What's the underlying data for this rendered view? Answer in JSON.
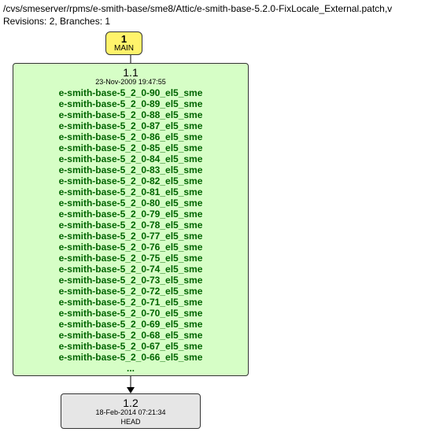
{
  "header": {
    "path": "/cvs/smeserver/rpms/e-smith-base/sme8/Attic/e-smith-base-5.2.0-FixLocale_External.patch,v",
    "revisions_label": "Revisions: 2, Branches: 1"
  },
  "badge": {
    "number": "1",
    "label": "MAIN"
  },
  "node1": {
    "version": "1.1",
    "timestamp": "23-Nov-2009 19:47:55",
    "tags": [
      "e-smith-base-5_2_0-90_el5_sme",
      "e-smith-base-5_2_0-89_el5_sme",
      "e-smith-base-5_2_0-88_el5_sme",
      "e-smith-base-5_2_0-87_el5_sme",
      "e-smith-base-5_2_0-86_el5_sme",
      "e-smith-base-5_2_0-85_el5_sme",
      "e-smith-base-5_2_0-84_el5_sme",
      "e-smith-base-5_2_0-83_el5_sme",
      "e-smith-base-5_2_0-82_el5_sme",
      "e-smith-base-5_2_0-81_el5_sme",
      "e-smith-base-5_2_0-80_el5_sme",
      "e-smith-base-5_2_0-79_el5_sme",
      "e-smith-base-5_2_0-78_el5_sme",
      "e-smith-base-5_2_0-77_el5_sme",
      "e-smith-base-5_2_0-76_el5_sme",
      "e-smith-base-5_2_0-75_el5_sme",
      "e-smith-base-5_2_0-74_el5_sme",
      "e-smith-base-5_2_0-73_el5_sme",
      "e-smith-base-5_2_0-72_el5_sme",
      "e-smith-base-5_2_0-71_el5_sme",
      "e-smith-base-5_2_0-70_el5_sme",
      "e-smith-base-5_2_0-69_el5_sme",
      "e-smith-base-5_2_0-68_el5_sme",
      "e-smith-base-5_2_0-67_el5_sme",
      "e-smith-base-5_2_0-66_el5_sme"
    ],
    "more": "..."
  },
  "node2": {
    "version": "1.2",
    "timestamp": "18-Feb-2014 07:21:34",
    "head": "HEAD"
  }
}
